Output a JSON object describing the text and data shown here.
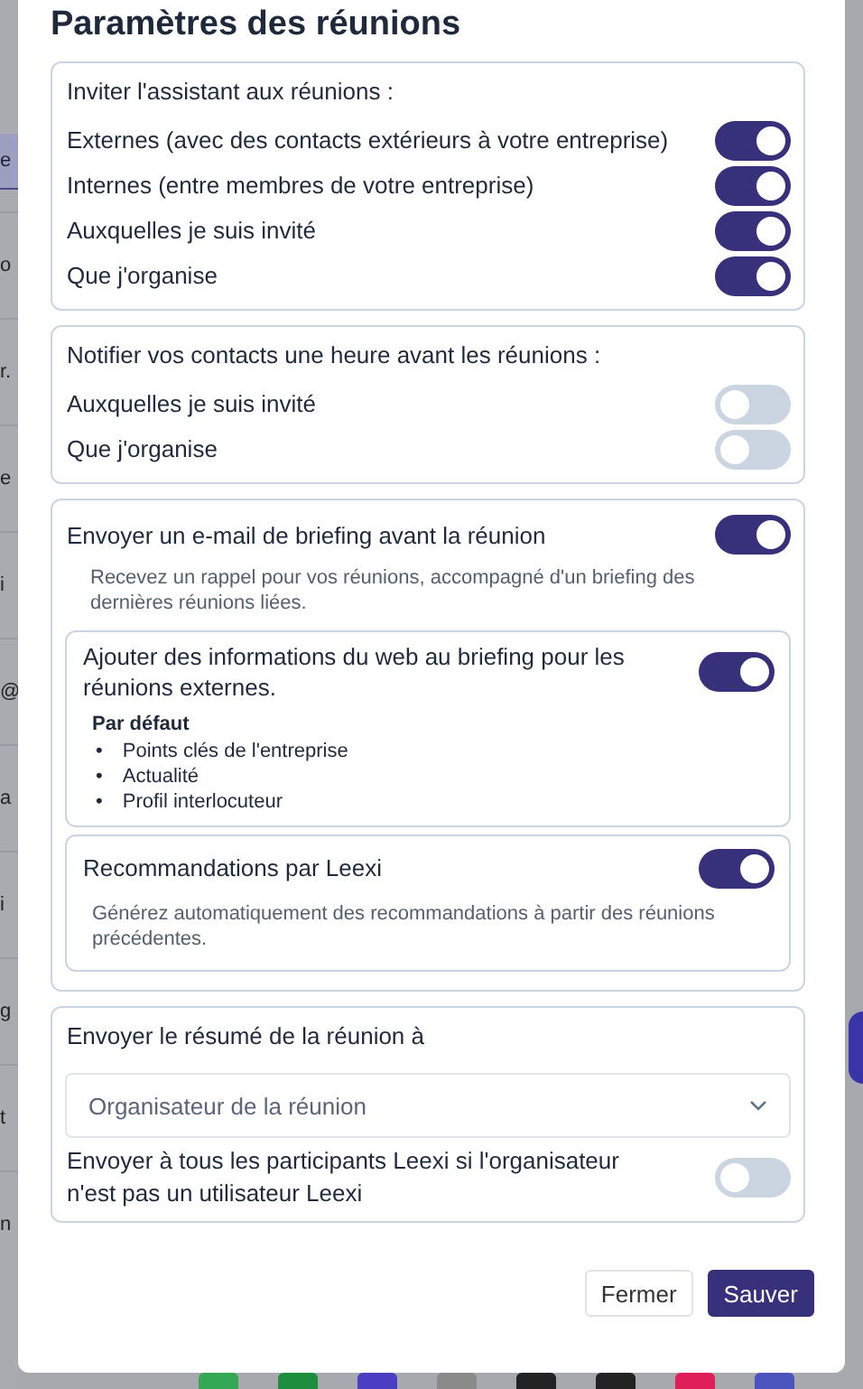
{
  "background": {
    "tab_fragment": "e",
    "fragments": [
      "o",
      "r.",
      "e",
      "i",
      "@",
      "a",
      "i",
      "g",
      "t",
      "n"
    ]
  },
  "modal": {
    "title": "Paramètres des réunions",
    "sections": [
      {
        "kind": "toggles",
        "heading": "Inviter l'assistant aux réunions :",
        "items": [
          {
            "label": "Externes (avec des contacts extérieurs à votre entreprise)",
            "on": true
          },
          {
            "label": "Internes (entre membres de votre entreprise)",
            "on": true
          },
          {
            "label": "Auxquelles je suis invité",
            "on": true
          },
          {
            "label": "Que j'organise",
            "on": true
          }
        ]
      },
      {
        "kind": "toggles",
        "heading": "Notifier vos contacts une heure avant les réunions :",
        "items": [
          {
            "label": "Auxquelles je suis invité",
            "on": false
          },
          {
            "label": "Que j'organise",
            "on": false
          }
        ]
      },
      {
        "kind": "briefing",
        "label": "Envoyer un e-mail de briefing avant la réunion",
        "on": true,
        "description": "Recevez un rappel pour vos réunions, accompagné d'un briefing des dernières réunions liées.",
        "cards": [
          {
            "label": "Ajouter des informations du web au briefing pour les réunions externes.",
            "on": true,
            "list_title": "Par défaut",
            "marker": "•",
            "list": [
              "Points clés de l'entreprise",
              "Actualité",
              "Profil interlocuteur"
            ]
          },
          {
            "label": "Recommandations par Leexi",
            "on": true,
            "description": "Générez automatiquement des recommandations à partir des réunions précédentes."
          }
        ]
      },
      {
        "kind": "summary",
        "heading": "Envoyer le résumé de la réunion à",
        "select": {
          "value": "Organisateur de la réunion"
        },
        "items": [
          {
            "label": "Envoyer à tous les participants Leexi si l'organisateur n'est pas un utilisateur Leexi",
            "on": false
          }
        ]
      }
    ],
    "buttons": [
      {
        "label": "Fermer",
        "kind": "secondary"
      },
      {
        "label": "Sauver",
        "kind": "primary"
      }
    ]
  }
}
